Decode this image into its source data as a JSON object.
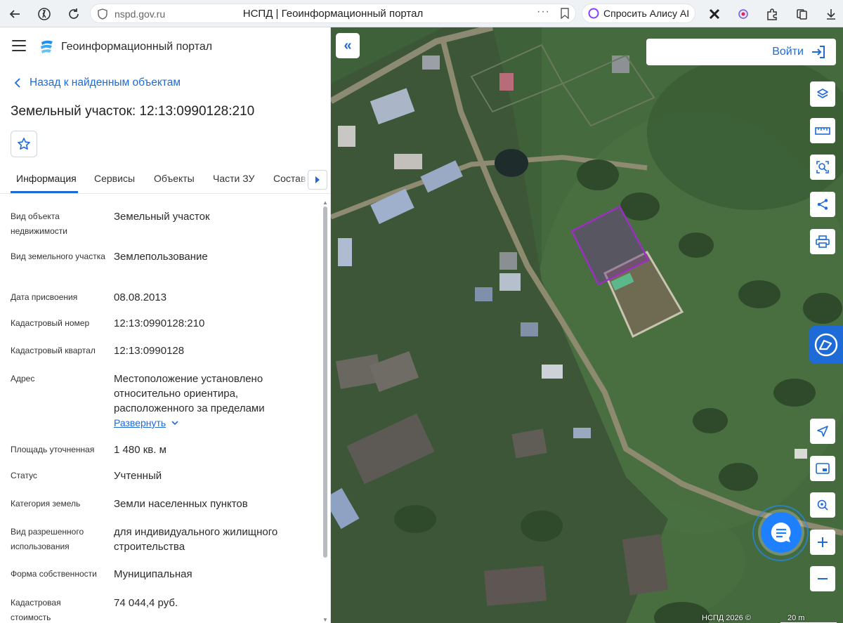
{
  "browser": {
    "url": "nspd.gov.ru",
    "page_title": "НСПД | Геоинформационный портал",
    "alice_label": "Спросить Алису AI",
    "more_dots": "···"
  },
  "header": {
    "portal_name": "Геоинформационный портал"
  },
  "nav": {
    "back_label": "Назад к найденным объектам"
  },
  "object": {
    "title": "Земельный участок: 12:13:0990128:210"
  },
  "tabs": [
    {
      "label": "Информация"
    },
    {
      "label": "Сервисы"
    },
    {
      "label": "Объекты"
    },
    {
      "label": "Части ЗУ"
    },
    {
      "label": "Состав"
    }
  ],
  "properties": [
    {
      "label": "Вид объекта недвижимости",
      "value": "Земельный участок"
    },
    {
      "label": "Вид земельного участка",
      "value": "Землепользование"
    },
    {
      "label": "Дата присвоения",
      "value": "08.08.2013"
    },
    {
      "label": "Кадастровый номер",
      "value": "12:13:0990128:210"
    },
    {
      "label": "Кадастровый квартал",
      "value": "12:13:0990128"
    },
    {
      "label": "Адрес",
      "value": "Местоположение установлено относительно ориентира, расположенного за пределами"
    },
    {
      "label": "Площадь уточненная",
      "value": "1 480 кв. м"
    },
    {
      "label": "Статус",
      "value": "Учтенный"
    },
    {
      "label": "Категория земель",
      "value": "Земли населенных пунктов"
    },
    {
      "label": "Вид разрешенного использования",
      "value": "для индивидуального жилищного строительства"
    },
    {
      "label": "Форма собственности",
      "value": "Муниципальная"
    },
    {
      "label": "Кадастровая стоимость",
      "value": "74 044,4 руб."
    }
  ],
  "expand_label": "Развернуть",
  "map": {
    "login_label": "Войти",
    "attribution": "НСПД 2026 ©",
    "scale_label": "20 m",
    "parcel_color": "#9b2fc4",
    "accent_color": "#1e6ad6"
  }
}
